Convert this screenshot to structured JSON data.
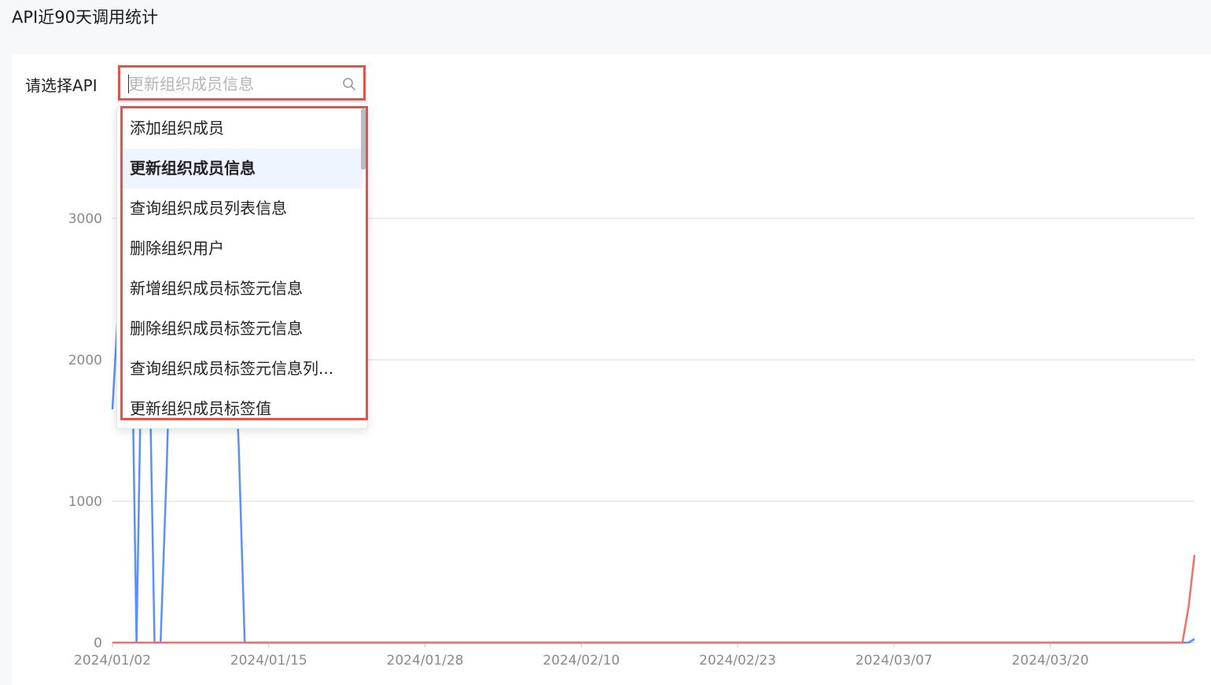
{
  "page": {
    "title": "API近90天调用统计"
  },
  "filter": {
    "label": "请选择API",
    "placeholder": "更新组织成员信息",
    "value": ""
  },
  "dropdown": {
    "options": [
      {
        "label": "添加组织成员",
        "active": false
      },
      {
        "label": "更新组织成员信息",
        "active": true
      },
      {
        "label": "查询组织成员列表信息",
        "active": false
      },
      {
        "label": "删除组织用户",
        "active": false
      },
      {
        "label": "新增组织成员标签元信息",
        "active": false
      },
      {
        "label": "删除组织成员标签元信息",
        "active": false
      },
      {
        "label": "查询组织成员标签元信息列...",
        "active": false
      },
      {
        "label": "更新组织成员标签值",
        "active": false
      }
    ]
  },
  "chart_data": {
    "type": "line",
    "y_ticks": [
      "0",
      "1000",
      "2000",
      "3000"
    ],
    "ylim": [
      0,
      3000
    ],
    "x_ticks": [
      "2024/01/02",
      "2024/01/15",
      "2024/01/28",
      "2024/02/10",
      "2024/02/23",
      "2024/03/07",
      "2024/03/20"
    ],
    "grid": true,
    "colors": {
      "blue": "#5b8ff9",
      "red": "#f2706a"
    },
    "series": [
      {
        "color": "#5b8ff9",
        "x": [
          0,
          0.5,
          1,
          1.5,
          2,
          2.5,
          3,
          3.5,
          4,
          4.5,
          5,
          5.5,
          6,
          7,
          8,
          9,
          10,
          10.5,
          11,
          20,
          30,
          40,
          50,
          60,
          70,
          80,
          89.5,
          90
        ],
        "values": [
          1650,
          2400,
          3050,
          2800,
          0,
          2500,
          2350,
          0,
          0,
          1200,
          2700,
          2900,
          3000,
          3000,
          3000,
          3000,
          2400,
          1400,
          0,
          0,
          0,
          0,
          0,
          0,
          0,
          0,
          0,
          25
        ]
      },
      {
        "color": "#f2706a",
        "x": [
          0,
          20,
          40,
          60,
          80,
          89,
          89.5,
          90
        ],
        "values": [
          0,
          0,
          0,
          0,
          0,
          0,
          250,
          620
        ]
      }
    ]
  }
}
